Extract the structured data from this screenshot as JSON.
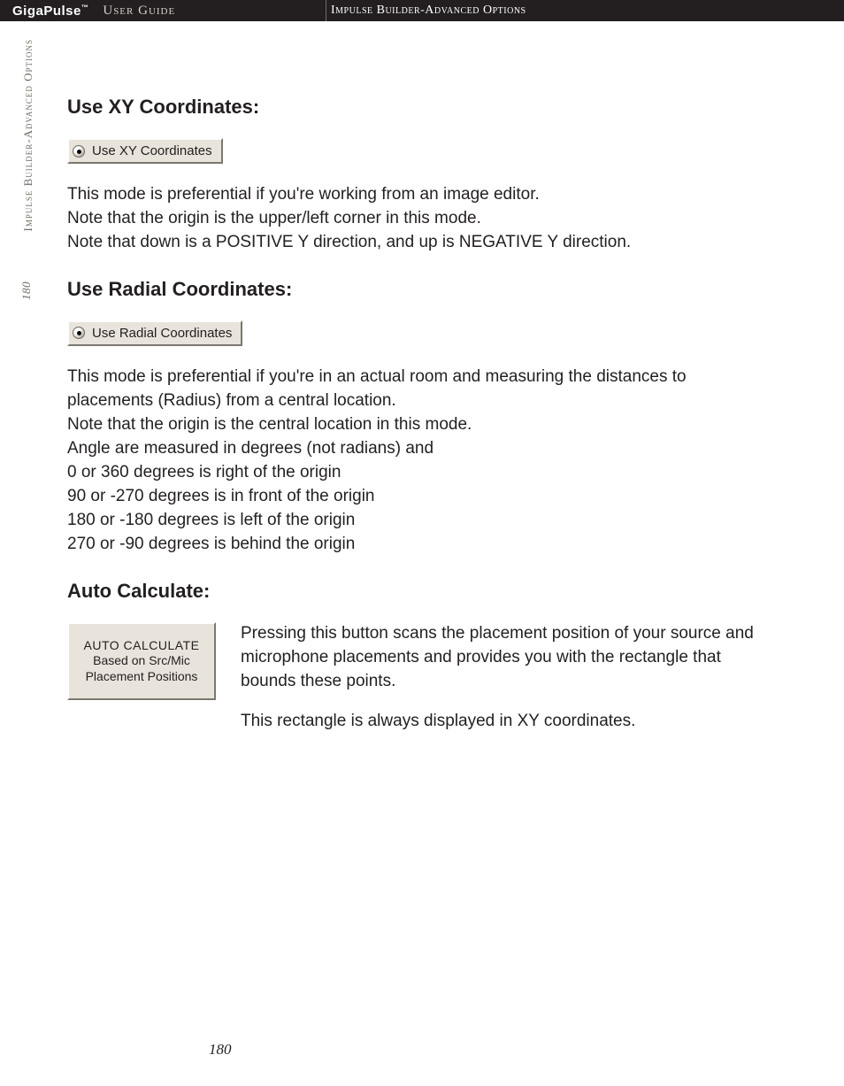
{
  "header": {
    "brand": "GigaPulse",
    "tm": "™",
    "doc_type": "User Guide",
    "section": "Impulse Builder-Advanced Options"
  },
  "side": {
    "tab": "Impulse Builder-Advanced Options",
    "page": "180"
  },
  "sections": {
    "xy": {
      "heading": "Use XY Coordinates:",
      "radio_label": "Use XY Coordinates",
      "body": "This mode is preferential if you're working from an image editor.\nNote that the origin is the upper/left corner in this mode.\nNote that down is a POSITIVE Y direction, and up is NEGATIVE Y direction."
    },
    "radial": {
      "heading": "Use Radial Coordinates:",
      "radio_label": "Use Radial Coordinates",
      "body": "This mode is preferential if you're in an actual room and measuring the distances to placements (Radius) from a central location.\nNote that the origin is the central location in this mode.\nAngle are measured in degrees (not radians) and\n0 or 360 degrees is right of the origin\n90 or -270 degrees is in front of the origin\n180 or -180 degrees is left of the origin\n270 or  -90 degrees is behind the origin"
    },
    "auto_calc": {
      "heading": "Auto Calculate:",
      "button_line1": "AUTO CALCULATE",
      "button_line2": "Based on Src/Mic",
      "button_line3": "Placement Positions",
      "para1": "Pressing this button scans the placement position of your source and microphone placements and provides you with the rectangle that bounds these points.",
      "para2": "This rectangle is always displayed in XY coordinates."
    }
  },
  "footer": {
    "page": "180"
  }
}
